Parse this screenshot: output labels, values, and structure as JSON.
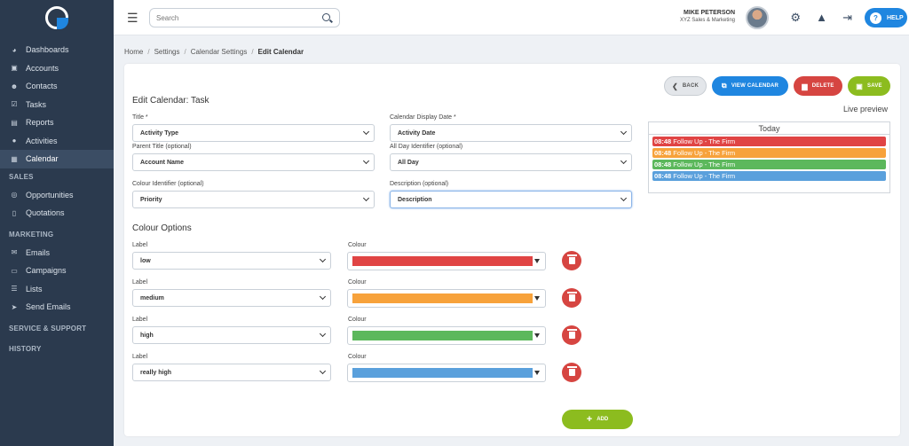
{
  "sidebar": {
    "items": [
      {
        "label": "Dashboards",
        "icon": "dashboard-icon",
        "glyph": "◕"
      },
      {
        "label": "Accounts",
        "icon": "building-icon",
        "glyph": "▣"
      },
      {
        "label": "Contacts",
        "icon": "users-icon",
        "glyph": "☻"
      },
      {
        "label": "Tasks",
        "icon": "checkbox-icon",
        "glyph": "☑"
      },
      {
        "label": "Reports",
        "icon": "file-icon",
        "glyph": "▤"
      },
      {
        "label": "Activities",
        "icon": "chat-icon",
        "glyph": "●"
      },
      {
        "label": "Calendar",
        "icon": "calendar-icon",
        "glyph": "▦"
      }
    ],
    "sections": {
      "sales": "SALES",
      "marketing": "MARKETING",
      "service": "SERVICE & SUPPORT",
      "history": "HISTORY"
    },
    "sales_items": [
      {
        "label": "Opportunities",
        "icon": "lightbulb-icon",
        "glyph": "◎"
      },
      {
        "label": "Quotations",
        "icon": "document-icon",
        "glyph": "▯"
      }
    ],
    "marketing_items": [
      {
        "label": "Emails",
        "icon": "envelope-icon",
        "glyph": "✉"
      },
      {
        "label": "Campaigns",
        "icon": "inbox-icon",
        "glyph": "▭"
      },
      {
        "label": "Lists",
        "icon": "list-icon",
        "glyph": "☰"
      },
      {
        "label": "Send Emails",
        "icon": "send-icon",
        "glyph": "➤"
      }
    ]
  },
  "topbar": {
    "search_placeholder": "Search",
    "user_name": "MIKE PETERSON",
    "user_company": "XYZ Sales & Marketing",
    "help_label": "HELP"
  },
  "breadcrumb": [
    "Home",
    "Settings",
    "Calendar Settings",
    "Edit Calendar"
  ],
  "toolbar": {
    "back_label": "BACK",
    "view_label": "VIEW CALENDAR",
    "delete_label": "DELETE",
    "save_label": "SAVE"
  },
  "form": {
    "title": "Edit Calendar: Task",
    "fields": {
      "title_label": "Title *",
      "title_value": "Activity Type",
      "display_date_label": "Calendar Display Date *",
      "display_date_value": "Activity Date",
      "parent_label": "Parent Title (optional)",
      "parent_value": "Account Name",
      "allday_label": "All Day Identifier (optional)",
      "allday_value": "All Day",
      "colour_id_label": "Colour Identifier (optional)",
      "colour_id_value": "Priority",
      "description_label": "Description (optional)",
      "description_value": "Description"
    }
  },
  "colour_options": {
    "title": "Colour Options",
    "label_caption": "Label",
    "colour_caption": "Colour",
    "rows": [
      {
        "label": "low",
        "color": "#e04444"
      },
      {
        "label": "medium",
        "color": "#f7a23b"
      },
      {
        "label": "high",
        "color": "#5cb85c"
      },
      {
        "label": "really high",
        "color": "#5aa0dc"
      }
    ],
    "add_label": "ADD"
  },
  "preview": {
    "label": "Live preview",
    "header": "Today",
    "events": [
      {
        "time": "08:48",
        "text": "Follow Up - The Firm",
        "color": "#e04444"
      },
      {
        "time": "08:48",
        "text": "Follow Up - The Firm",
        "color": "#f7a23b"
      },
      {
        "time": "08:48",
        "text": "Follow Up - The Firm",
        "color": "#5cb85c"
      },
      {
        "time": "08:48",
        "text": "Follow Up - The Firm",
        "color": "#5aa0dc"
      }
    ]
  },
  "colors": {
    "sidebar_bg": "#2b3a4e",
    "accent_blue": "#1f86e0",
    "danger_red": "#d64541",
    "success_green": "#8cbc1f"
  }
}
